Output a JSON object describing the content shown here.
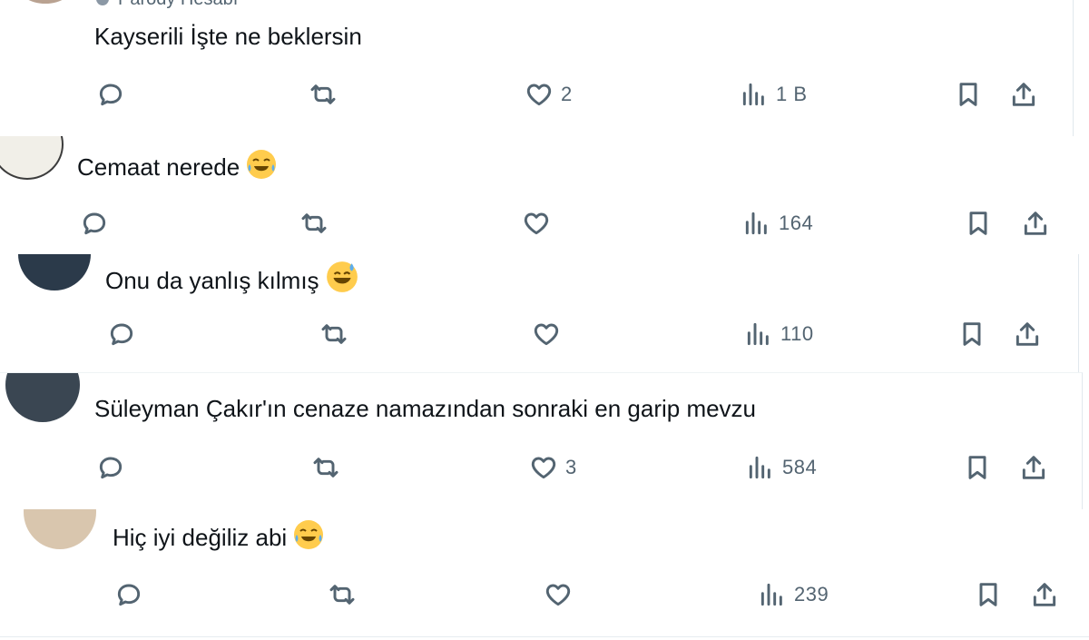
{
  "replies": [
    {
      "handle": "Parody Hesabı",
      "text": "Kayserili İşte ne beklersin",
      "emoji": "",
      "likes": "2",
      "views": "1 B"
    },
    {
      "text": "Cemaat nerede",
      "emoji": "joy-emoji",
      "likes": "",
      "views": "164"
    },
    {
      "text": "Onu da yanlış kılmış",
      "emoji": "sweat-smile-emoji",
      "likes": "",
      "views": "110"
    },
    {
      "text": "Süleyman Çakır'ın cenaze namazından sonraki en garip mevzu",
      "emoji": "",
      "likes": "3",
      "views": "584"
    },
    {
      "text": "Hiç iyi değiliz abi",
      "emoji": "joy-emoji",
      "likes": "",
      "views": "239"
    }
  ],
  "colors": {
    "text": "#0f1419",
    "icon": "#536471",
    "divider": "#eff3f4",
    "emoji_face": "#ffcc4d"
  },
  "icons": [
    "reply-icon",
    "retweet-icon",
    "like-icon",
    "views-icon",
    "bookmark-icon",
    "share-icon"
  ]
}
